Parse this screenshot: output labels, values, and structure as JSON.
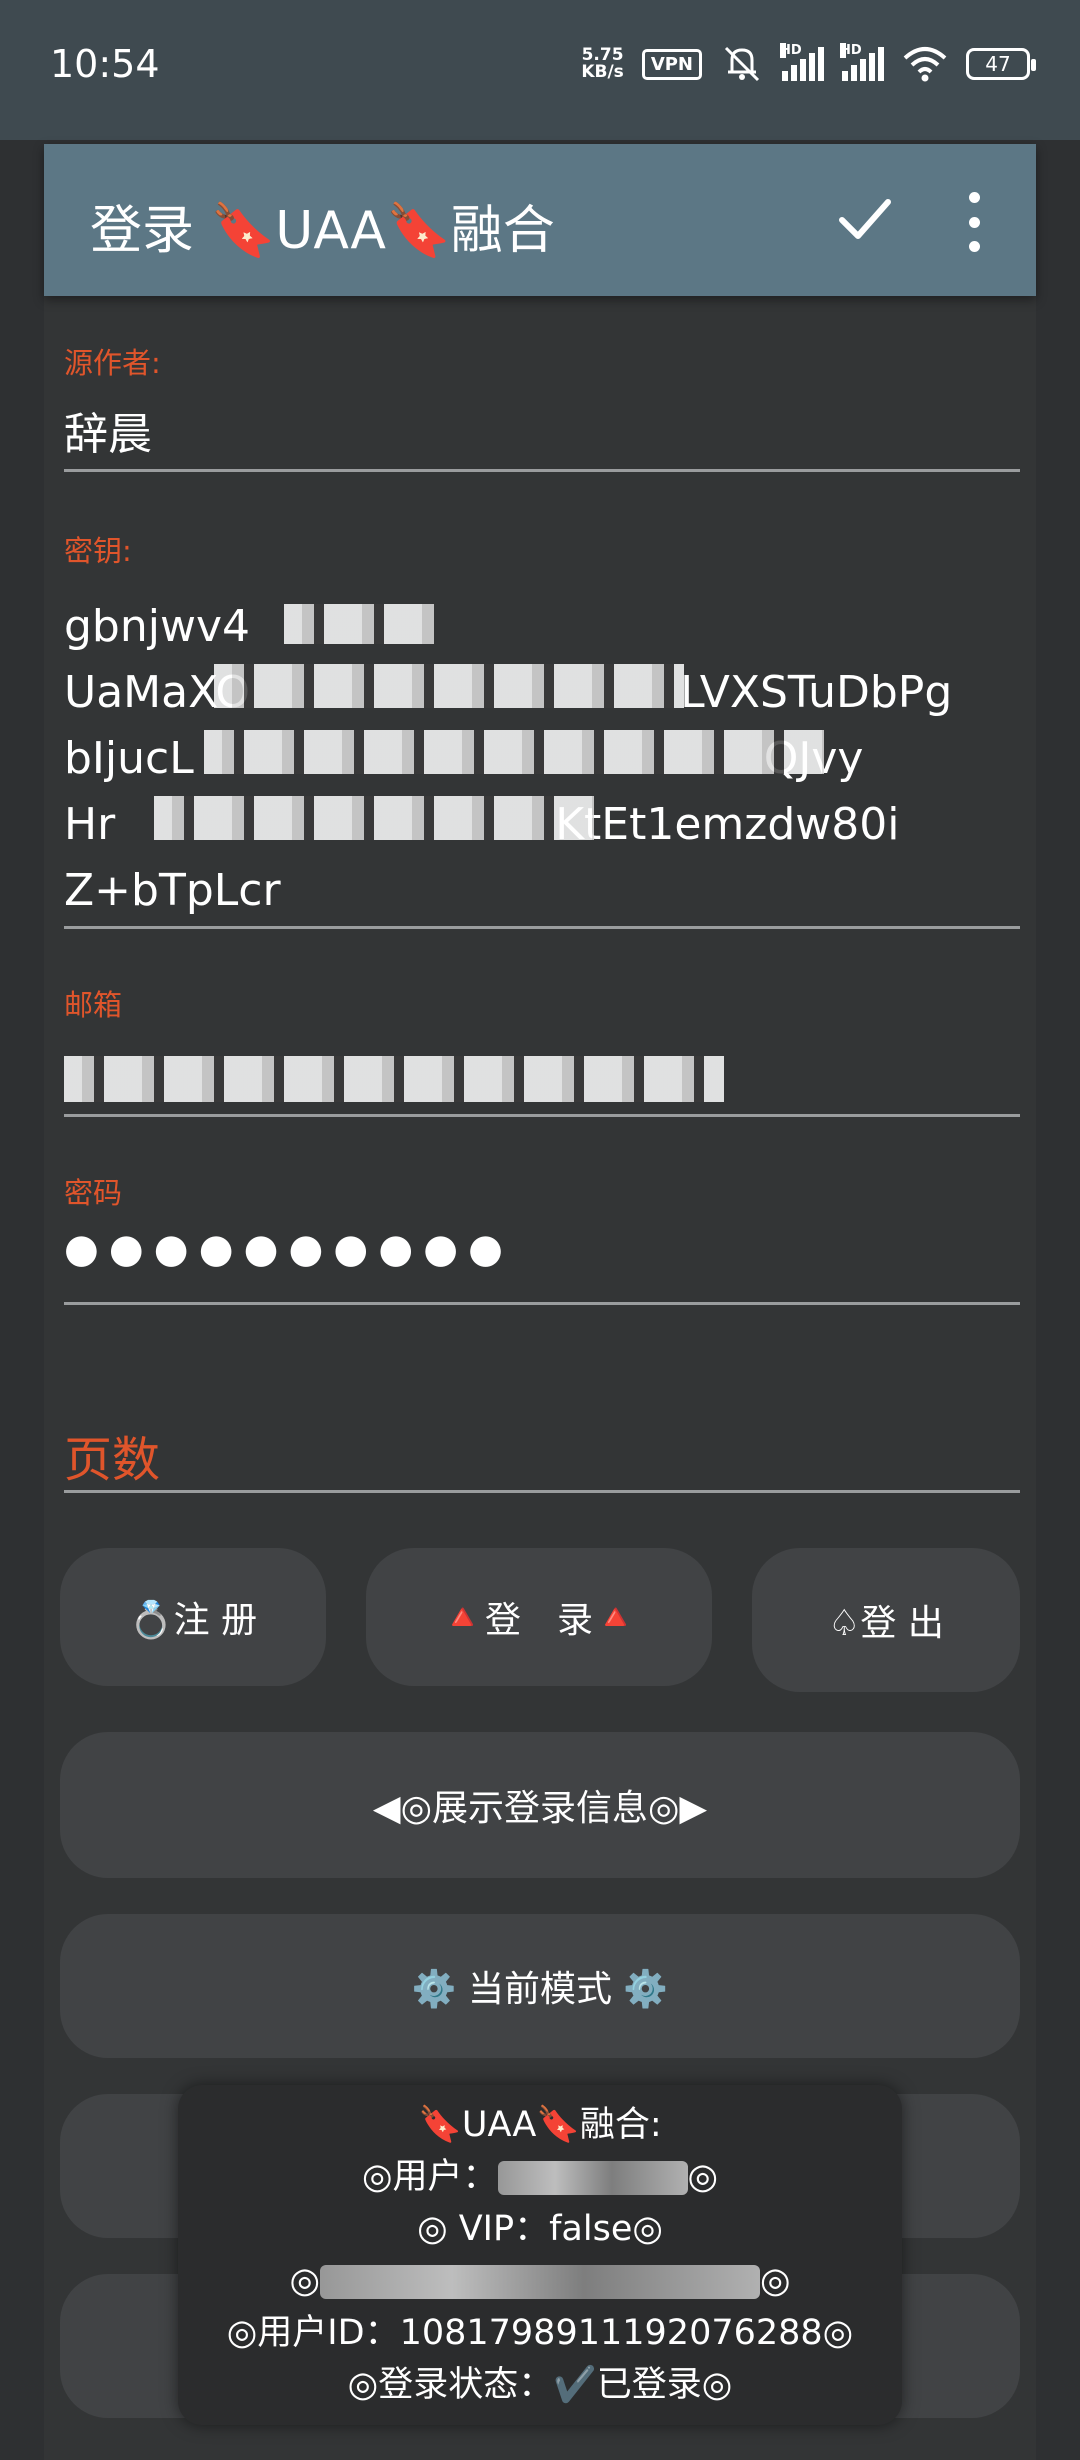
{
  "status_bar": {
    "time": "10:54",
    "speed_value": "5.75",
    "speed_unit": "KB/s",
    "vpn": "VPN",
    "hd": "HD",
    "battery": "47"
  },
  "appbar": {
    "title_prefix": "登录 ",
    "tag_icon": "🔖",
    "title_mid": "UAA",
    "title_suffix": "融合"
  },
  "fields": {
    "author_label": "源作者:",
    "author_value": "辞晨",
    "key_label": "密钥:",
    "key_lines": [
      "gbnjwv4",
      "UaMaXO",
      "bIjucL",
      "Hr",
      "Z+bTpLcr"
    ],
    "key_tail_lines": [
      "",
      "LVXSTuDbPg",
      "QJvy",
      "KtEt1emzdw80i",
      ""
    ],
    "email_label": "邮箱",
    "password_label": "密码",
    "password_value": "●●●●●●●●●●",
    "pages_label": "页数"
  },
  "buttons": {
    "register": "💍注 册",
    "login_icon": "🔺",
    "login": "登　录",
    "logout": "♤登 出",
    "show_info": "◀◎展示登录信息◎▶",
    "mode": "⚙️ 当前模式 ⚙️"
  },
  "toast": {
    "title": "🔖UAA🔖融合:",
    "user_prefix": "◎用户：",
    "user_suffix": "◎",
    "vip": "◎ VIP：false◎",
    "email_prefix": "◎",
    "email_suffix": "◎",
    "user_id": "◎用户ID：1081798911192076288◎",
    "login_state_prefix": "◎登录状态：",
    "login_state_icon": "✔️",
    "login_state_value": "已登录◎"
  }
}
